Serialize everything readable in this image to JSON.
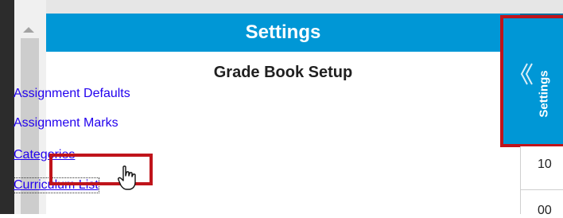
{
  "panel": {
    "title": "Settings",
    "section_title": "Grade Book Setup",
    "links": [
      {
        "label": "Assignment Defaults"
      },
      {
        "label": "Assignment Marks"
      },
      {
        "label": "Categories"
      },
      {
        "label": "Curriculum List"
      }
    ]
  },
  "side_panel": {
    "label": "Settings",
    "cells": [
      "10",
      "00"
    ]
  },
  "colors": {
    "header_blue": "#0097d6",
    "highlight_red": "#c0141b",
    "link_blue": "#2200ee"
  },
  "icons": [
    "hand-pointer-icon",
    "double-chevron-left-icon",
    "scroll-up-arrow-icon"
  ]
}
